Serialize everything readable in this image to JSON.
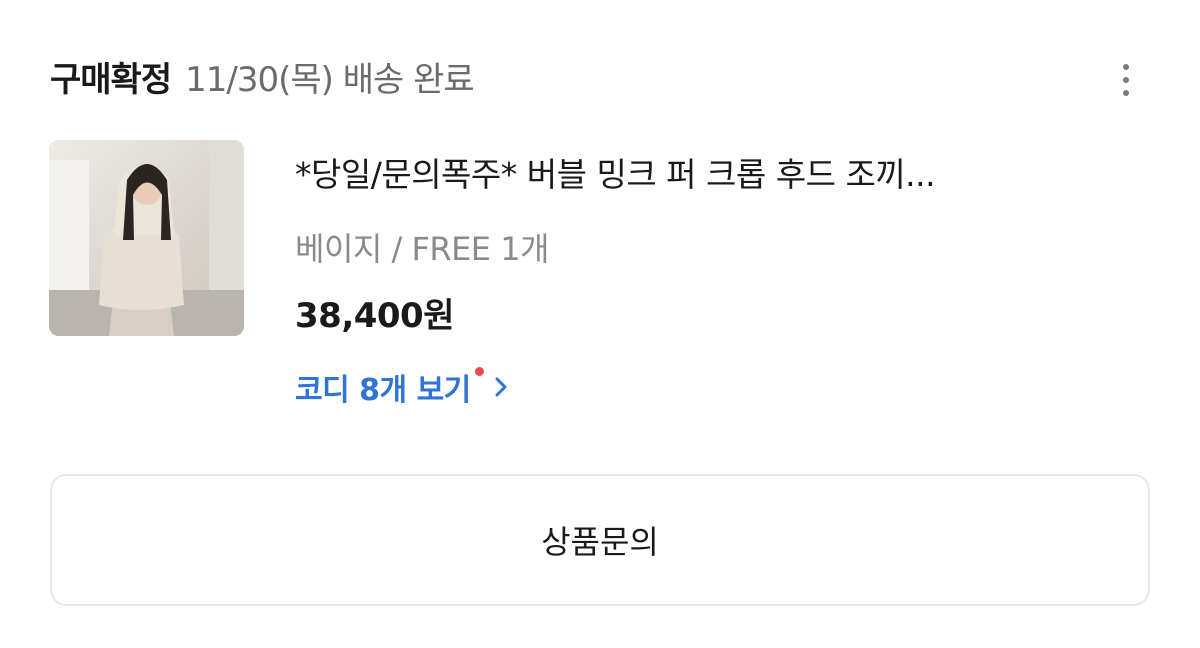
{
  "order": {
    "status": "구매확정",
    "delivery_info": "11/30(목) 배송 완료"
  },
  "product": {
    "title": "*당일/문의폭주* 버블 밍크 퍼 크롭 후드 조끼...",
    "option": "베이지 / FREE 1개",
    "price": "38,400원",
    "coordi_link": "코디 8개 보기"
  },
  "actions": {
    "inquiry_button": "상품문의"
  },
  "colors": {
    "link": "#2f74d6",
    "new_dot": "#ef4a56",
    "muted_text": "#8a8a8a"
  },
  "icons": {
    "more": "more-vertical-icon",
    "chevron": "chevron-right-icon"
  }
}
